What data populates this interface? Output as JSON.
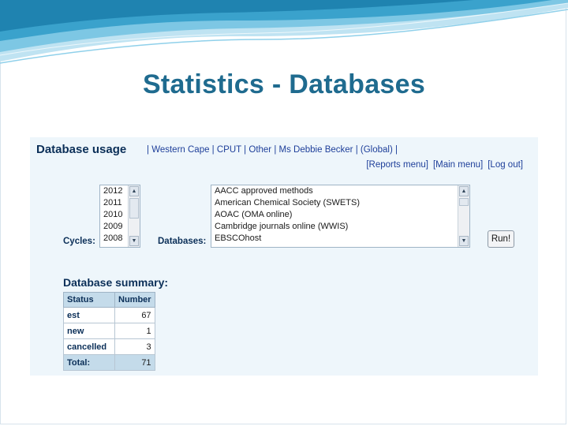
{
  "slide": {
    "title": "Statistics - Databases"
  },
  "panel": {
    "heading": "Database usage",
    "context": [
      "Western Cape",
      "CPUT",
      "Other",
      "Ms Debbie Becker",
      "(Global)"
    ],
    "nav": [
      "[Reports menu]",
      "[Main menu]",
      "[Log out]"
    ]
  },
  "cycles": {
    "label": "Cycles:",
    "options": [
      "2012",
      "2011",
      "2010",
      "2009",
      "2008"
    ]
  },
  "databases": {
    "label": "Databases:",
    "options": [
      "AACC approved methods",
      "American Chemical Society (SWETS)",
      "AOAC (OMA online)",
      "Cambridge journals online (WWIS)",
      "EBSCOhost"
    ]
  },
  "run_label": "Run!",
  "summary": {
    "heading": "Database summary:",
    "headers": [
      "Status",
      "Number"
    ],
    "rows": [
      {
        "status": "est",
        "number": "67"
      },
      {
        "status": "new",
        "number": "1"
      },
      {
        "status": "cancelled",
        "number": "3"
      }
    ],
    "total": {
      "status": "Total:",
      "number": "71"
    }
  },
  "colors": {
    "title": "#1f6b8f",
    "panel_bg": "#eef6fb",
    "header_bg": "#c4dbea",
    "link": "#1e3f9a"
  }
}
